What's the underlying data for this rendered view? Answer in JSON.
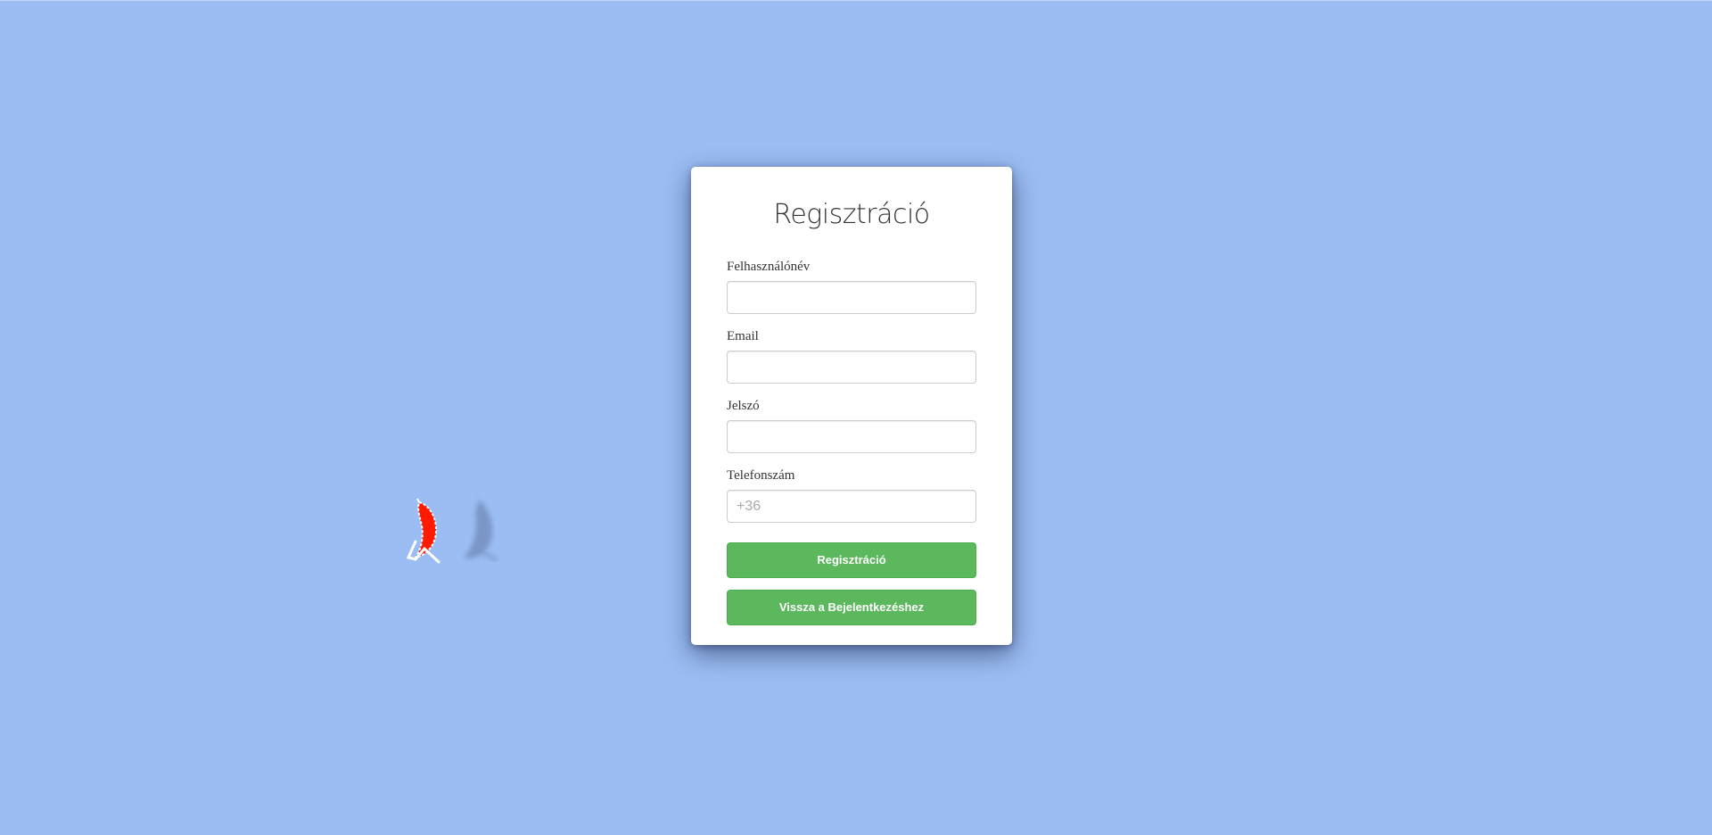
{
  "form": {
    "title": "Regisztráció",
    "fields": [
      {
        "label": "Felhasználónév",
        "value": "",
        "placeholder": ""
      },
      {
        "label": "Email",
        "value": "",
        "placeholder": ""
      },
      {
        "label": "Jelszó",
        "value": "",
        "placeholder": ""
      },
      {
        "label": "Telefonszám",
        "value": "",
        "placeholder": "+36"
      }
    ],
    "submit_label": "Regisztráció",
    "back_label": "Vissza a Bejelentkezéshez"
  },
  "decoration": {
    "icon": "paraglider-icon",
    "canopy_color": "#ff1a00"
  },
  "colors": {
    "background": "#9bbdf3",
    "button": "#5cb85c"
  }
}
